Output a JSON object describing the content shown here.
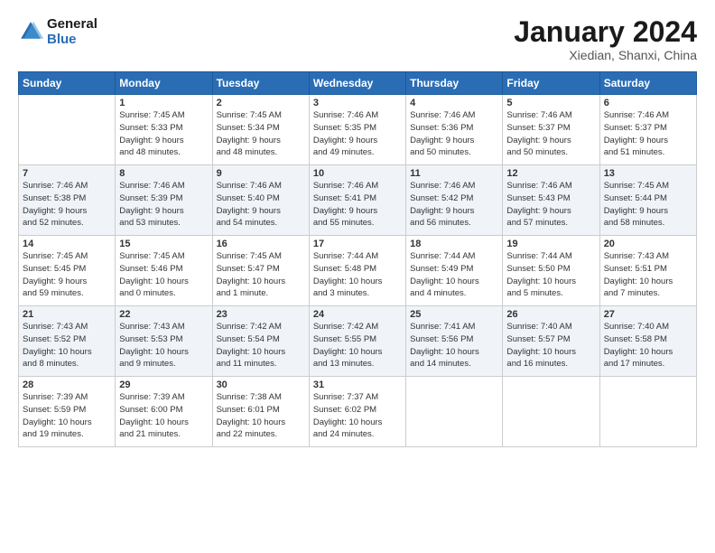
{
  "header": {
    "logo_line1": "General",
    "logo_line2": "Blue",
    "month_year": "January 2024",
    "location": "Xiedian, Shanxi, China"
  },
  "weekdays": [
    "Sunday",
    "Monday",
    "Tuesday",
    "Wednesday",
    "Thursday",
    "Friday",
    "Saturday"
  ],
  "weeks": [
    [
      {
        "day": "",
        "info": ""
      },
      {
        "day": "1",
        "info": "Sunrise: 7:45 AM\nSunset: 5:33 PM\nDaylight: 9 hours\nand 48 minutes."
      },
      {
        "day": "2",
        "info": "Sunrise: 7:45 AM\nSunset: 5:34 PM\nDaylight: 9 hours\nand 48 minutes."
      },
      {
        "day": "3",
        "info": "Sunrise: 7:46 AM\nSunset: 5:35 PM\nDaylight: 9 hours\nand 49 minutes."
      },
      {
        "day": "4",
        "info": "Sunrise: 7:46 AM\nSunset: 5:36 PM\nDaylight: 9 hours\nand 50 minutes."
      },
      {
        "day": "5",
        "info": "Sunrise: 7:46 AM\nSunset: 5:37 PM\nDaylight: 9 hours\nand 50 minutes."
      },
      {
        "day": "6",
        "info": "Sunrise: 7:46 AM\nSunset: 5:37 PM\nDaylight: 9 hours\nand 51 minutes."
      }
    ],
    [
      {
        "day": "7",
        "info": "Sunrise: 7:46 AM\nSunset: 5:38 PM\nDaylight: 9 hours\nand 52 minutes."
      },
      {
        "day": "8",
        "info": "Sunrise: 7:46 AM\nSunset: 5:39 PM\nDaylight: 9 hours\nand 53 minutes."
      },
      {
        "day": "9",
        "info": "Sunrise: 7:46 AM\nSunset: 5:40 PM\nDaylight: 9 hours\nand 54 minutes."
      },
      {
        "day": "10",
        "info": "Sunrise: 7:46 AM\nSunset: 5:41 PM\nDaylight: 9 hours\nand 55 minutes."
      },
      {
        "day": "11",
        "info": "Sunrise: 7:46 AM\nSunset: 5:42 PM\nDaylight: 9 hours\nand 56 minutes."
      },
      {
        "day": "12",
        "info": "Sunrise: 7:46 AM\nSunset: 5:43 PM\nDaylight: 9 hours\nand 57 minutes."
      },
      {
        "day": "13",
        "info": "Sunrise: 7:45 AM\nSunset: 5:44 PM\nDaylight: 9 hours\nand 58 minutes."
      }
    ],
    [
      {
        "day": "14",
        "info": "Sunrise: 7:45 AM\nSunset: 5:45 PM\nDaylight: 9 hours\nand 59 minutes."
      },
      {
        "day": "15",
        "info": "Sunrise: 7:45 AM\nSunset: 5:46 PM\nDaylight: 10 hours\nand 0 minutes."
      },
      {
        "day": "16",
        "info": "Sunrise: 7:45 AM\nSunset: 5:47 PM\nDaylight: 10 hours\nand 1 minute."
      },
      {
        "day": "17",
        "info": "Sunrise: 7:44 AM\nSunset: 5:48 PM\nDaylight: 10 hours\nand 3 minutes."
      },
      {
        "day": "18",
        "info": "Sunrise: 7:44 AM\nSunset: 5:49 PM\nDaylight: 10 hours\nand 4 minutes."
      },
      {
        "day": "19",
        "info": "Sunrise: 7:44 AM\nSunset: 5:50 PM\nDaylight: 10 hours\nand 5 minutes."
      },
      {
        "day": "20",
        "info": "Sunrise: 7:43 AM\nSunset: 5:51 PM\nDaylight: 10 hours\nand 7 minutes."
      }
    ],
    [
      {
        "day": "21",
        "info": "Sunrise: 7:43 AM\nSunset: 5:52 PM\nDaylight: 10 hours\nand 8 minutes."
      },
      {
        "day": "22",
        "info": "Sunrise: 7:43 AM\nSunset: 5:53 PM\nDaylight: 10 hours\nand 9 minutes."
      },
      {
        "day": "23",
        "info": "Sunrise: 7:42 AM\nSunset: 5:54 PM\nDaylight: 10 hours\nand 11 minutes."
      },
      {
        "day": "24",
        "info": "Sunrise: 7:42 AM\nSunset: 5:55 PM\nDaylight: 10 hours\nand 13 minutes."
      },
      {
        "day": "25",
        "info": "Sunrise: 7:41 AM\nSunset: 5:56 PM\nDaylight: 10 hours\nand 14 minutes."
      },
      {
        "day": "26",
        "info": "Sunrise: 7:40 AM\nSunset: 5:57 PM\nDaylight: 10 hours\nand 16 minutes."
      },
      {
        "day": "27",
        "info": "Sunrise: 7:40 AM\nSunset: 5:58 PM\nDaylight: 10 hours\nand 17 minutes."
      }
    ],
    [
      {
        "day": "28",
        "info": "Sunrise: 7:39 AM\nSunset: 5:59 PM\nDaylight: 10 hours\nand 19 minutes."
      },
      {
        "day": "29",
        "info": "Sunrise: 7:39 AM\nSunset: 6:00 PM\nDaylight: 10 hours\nand 21 minutes."
      },
      {
        "day": "30",
        "info": "Sunrise: 7:38 AM\nSunset: 6:01 PM\nDaylight: 10 hours\nand 22 minutes."
      },
      {
        "day": "31",
        "info": "Sunrise: 7:37 AM\nSunset: 6:02 PM\nDaylight: 10 hours\nand 24 minutes."
      },
      {
        "day": "",
        "info": ""
      },
      {
        "day": "",
        "info": ""
      },
      {
        "day": "",
        "info": ""
      }
    ]
  ]
}
